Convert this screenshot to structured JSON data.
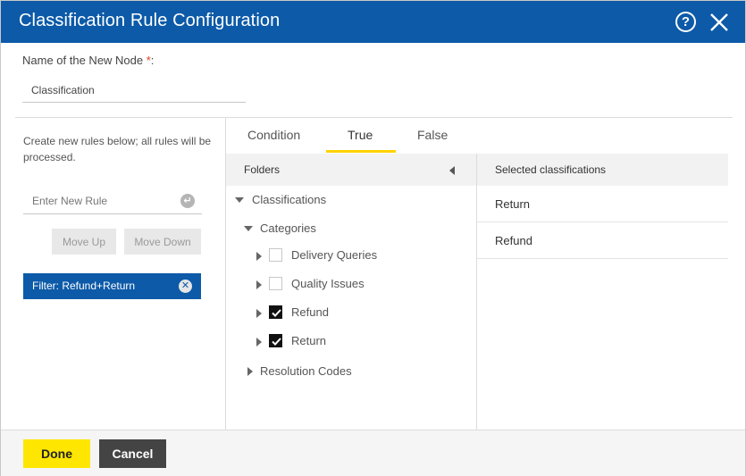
{
  "dialog": {
    "title": "Classification Rule Configuration",
    "help_icon": "question-circle-icon",
    "close_icon": "close-x-icon"
  },
  "node": {
    "label": "Name of the New Node ",
    "required_mark": "*",
    "label_suffix": ":",
    "value": "Classification"
  },
  "rules": {
    "hint": "Create new rules below; all rules will be processed.",
    "input_placeholder": "Enter New Rule",
    "enter_icon": "enter-return-icon",
    "move_up": "Move Up",
    "move_down": "Move Down",
    "filter_chip": "Filter: Refund+Return"
  },
  "tabs": [
    {
      "label": "Condition"
    },
    {
      "label": "True",
      "active": true
    },
    {
      "label": "False"
    }
  ],
  "folders": {
    "header": "Folders",
    "tree": {
      "root": "Classifications",
      "categories": "Categories",
      "items": [
        {
          "label": "Delivery Queries",
          "checked": false
        },
        {
          "label": "Quality Issues",
          "checked": false
        },
        {
          "label": "Refund",
          "checked": true
        },
        {
          "label": "Return",
          "checked": true
        }
      ],
      "resolution": "Resolution Codes"
    }
  },
  "selected": {
    "header": "Selected classifications",
    "items": [
      "Return",
      "Refund"
    ]
  },
  "footer": {
    "done": "Done",
    "cancel": "Cancel"
  },
  "colors": {
    "brand_blue": "#0c5aa8",
    "accent_yellow": "#ffe600",
    "dark_button": "#444444"
  }
}
